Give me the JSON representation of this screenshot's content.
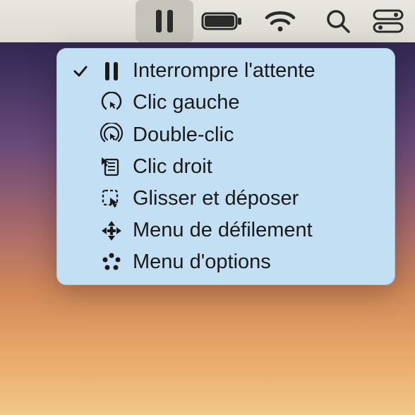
{
  "menu_items": [
    {
      "id": "pause-dwell",
      "label": "Interrompre l'attente",
      "checked": true
    },
    {
      "id": "left-click",
      "label": "Clic gauche",
      "checked": false
    },
    {
      "id": "double-click",
      "label": "Double-clic",
      "checked": false
    },
    {
      "id": "right-click",
      "label": "Clic droit",
      "checked": false
    },
    {
      "id": "drag-drop",
      "label": "Glisser et déposer",
      "checked": false
    },
    {
      "id": "scroll-menu",
      "label": "Menu de défilement",
      "checked": false
    },
    {
      "id": "options-menu",
      "label": "Menu d'options",
      "checked": false
    }
  ]
}
